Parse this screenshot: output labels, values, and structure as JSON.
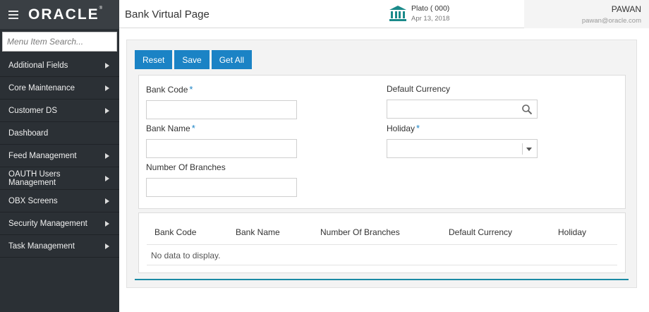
{
  "brand": {
    "logo": "ORACLE",
    "mark": "®"
  },
  "sidebar": {
    "search_placeholder": "Menu Item Search...",
    "items": [
      {
        "label": "Additional Fields",
        "has_children": true
      },
      {
        "label": "Core Maintenance",
        "has_children": true
      },
      {
        "label": "Customer DS",
        "has_children": true
      },
      {
        "label": "Dashboard",
        "has_children": false
      },
      {
        "label": "Feed Management",
        "has_children": true
      },
      {
        "label": "OAUTH Users Management",
        "has_children": true
      },
      {
        "label": "OBX Screens",
        "has_children": true
      },
      {
        "label": "Security Management",
        "has_children": true
      },
      {
        "label": "Task Management",
        "has_children": true
      }
    ]
  },
  "header": {
    "title": "Bank Virtual Page",
    "branch": {
      "name": "Plato  ( 000)",
      "date": "Apr 13, 2018",
      "icon": "bank-icon"
    },
    "user": {
      "name": "PAWAN",
      "email": "pawan@oracle.com"
    }
  },
  "toolbar": {
    "reset_label": "Reset",
    "save_label": "Save",
    "getall_label": "Get All"
  },
  "form": {
    "bank_code": {
      "label": "Bank Code",
      "required": "*",
      "value": ""
    },
    "default_currency": {
      "label": "Default Currency",
      "value": ""
    },
    "bank_name": {
      "label": "Bank Name",
      "required": "*",
      "value": ""
    },
    "holiday": {
      "label": "Holiday",
      "required": "*",
      "value": ""
    },
    "number_of_branches": {
      "label": "Number Of Branches",
      "value": ""
    }
  },
  "table": {
    "columns": [
      "Bank Code",
      "Bank Name",
      "Number Of Branches",
      "Default Currency",
      "Holiday"
    ],
    "rows": [],
    "empty_message": "No data to display."
  },
  "colors": {
    "accent": "#1b83c5",
    "sidebar_bg": "#2b3035",
    "teal_line": "#1a8aa4"
  }
}
